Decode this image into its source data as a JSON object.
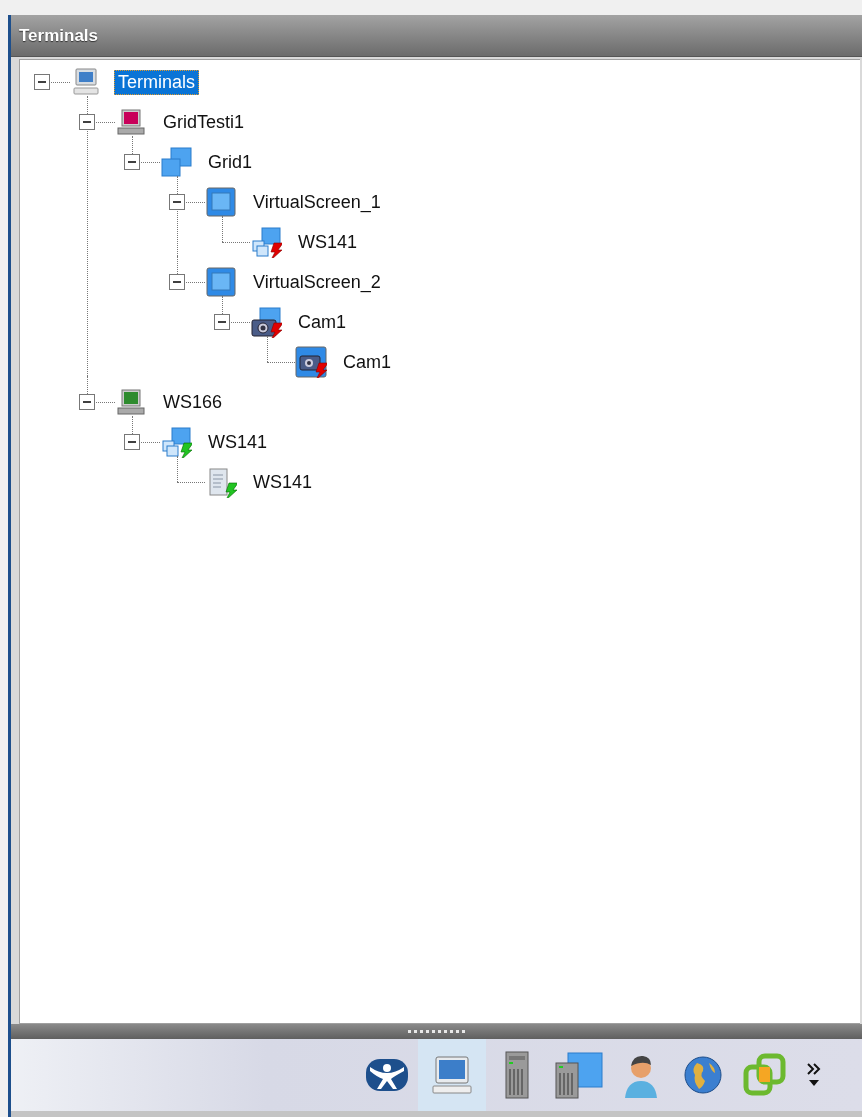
{
  "pane": {
    "title": "Terminals"
  },
  "tree": [
    {
      "label": "Terminals",
      "kind": "computer",
      "selected": true,
      "expanded": true,
      "children": [
        {
          "label": "GridTesti1",
          "kind": "terminal",
          "color": "#c8005a",
          "selected": false,
          "expanded": true,
          "children": [
            {
              "label": "Grid1",
              "kind": "grid",
              "selected": false,
              "expanded": true,
              "children": [
                {
                  "label": "VirtualScreen_1",
                  "kind": "screen",
                  "selected": false,
                  "expanded": true,
                  "children": [
                    {
                      "label": "WS141",
                      "kind": "session",
                      "connected": false,
                      "selected": false
                    }
                  ]
                },
                {
                  "label": "VirtualScreen_2",
                  "kind": "screen",
                  "selected": false,
                  "expanded": true,
                  "children": [
                    {
                      "label": "Cam1",
                      "kind": "camera",
                      "connected": false,
                      "selected": false,
                      "expanded": true,
                      "children": [
                        {
                          "label": "Cam1",
                          "kind": "camera-screen",
                          "connected": false,
                          "selected": false
                        }
                      ]
                    }
                  ]
                }
              ]
            }
          ]
        },
        {
          "label": "WS166",
          "kind": "terminal",
          "color": "#2e8b2e",
          "selected": false,
          "expanded": true,
          "children": [
            {
              "label": "WS141",
              "kind": "session",
              "connected": true,
              "selected": false,
              "expanded": true,
              "children": [
                {
                  "label": "WS141",
                  "kind": "application",
                  "connected": true,
                  "selected": false
                }
              ]
            }
          ]
        }
      ]
    }
  ],
  "toolbar": [
    {
      "kind": "logo",
      "selected": false
    },
    {
      "kind": "terminals",
      "selected": true
    },
    {
      "kind": "server",
      "selected": false
    },
    {
      "kind": "server-screen",
      "selected": false
    },
    {
      "kind": "user",
      "selected": false
    },
    {
      "kind": "globe",
      "selected": false
    },
    {
      "kind": "squares",
      "selected": false
    },
    {
      "kind": "overflow"
    }
  ]
}
